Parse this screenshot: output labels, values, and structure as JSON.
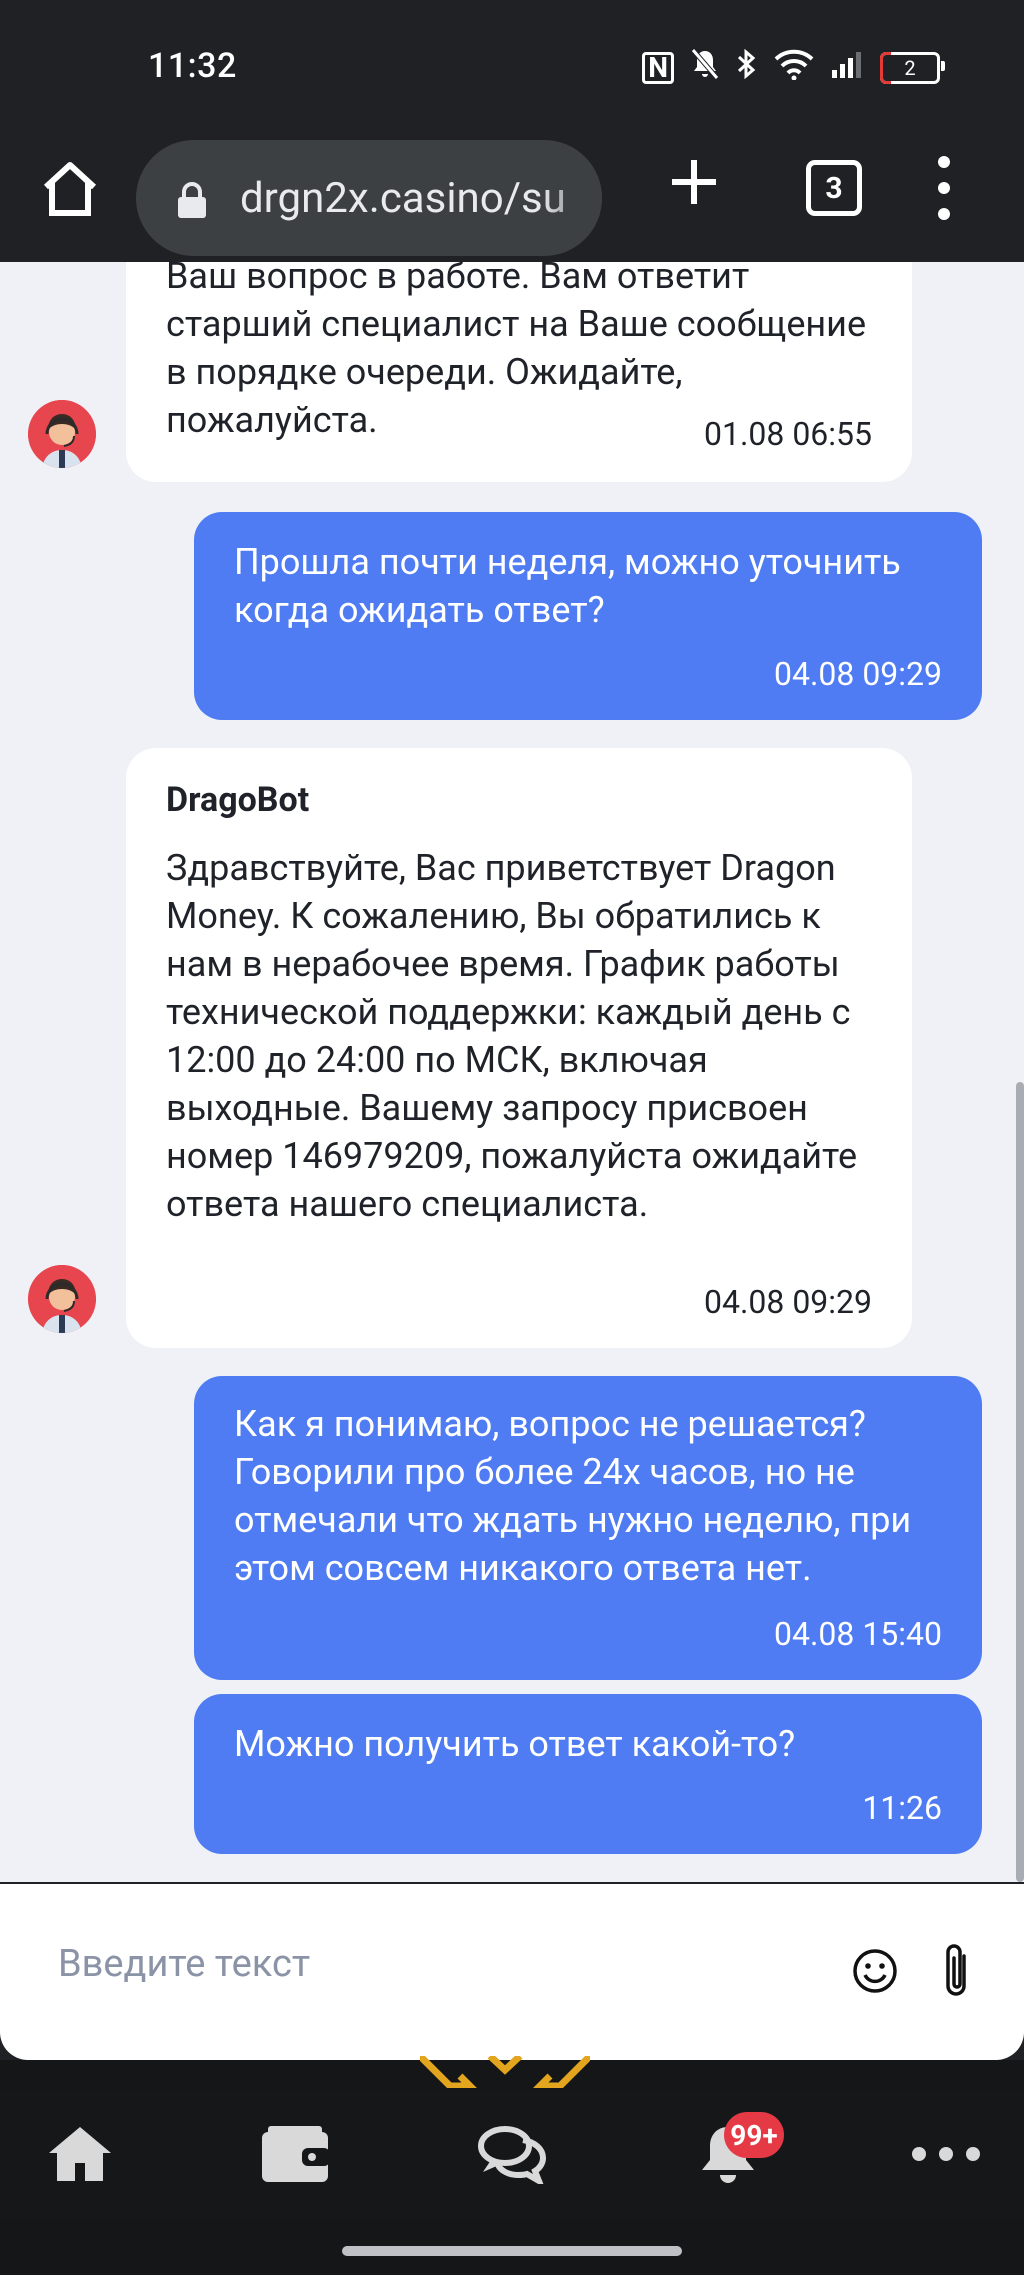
{
  "status_bar": {
    "time": "11:32",
    "battery_level": "2",
    "icons": [
      "nfc-icon",
      "mute-icon",
      "bluetooth-icon",
      "wifi-icon",
      "signal-icon",
      "battery-icon"
    ]
  },
  "browser": {
    "url": "drgn2x.casino/su",
    "tab_count": "3"
  },
  "chat": {
    "messages": [
      {
        "direction": "incoming",
        "text": "Ваш вопрос в работе. Вам ответит старший специалист на Ваше сообщение в порядке очереди. Ожидайте, пожалуйста.",
        "time": "01.08 06:55"
      },
      {
        "direction": "outgoing",
        "text": "Прошла почти неделя, можно уточнить когда ожидать ответ?",
        "time": "04.08 09:29"
      },
      {
        "direction": "incoming",
        "sender": "DragoBot",
        "text": "Здравствуйте, Вас приветствует Dragon Money. К сожалению, Вы обратились к нам в нерабочее время. График работы технической поддержки: каждый день с 12:00 до 24:00 по МСК, включая выходные. Вашему запросу присвоен номер 146979209, пожалуйста ожидайте ответа нашего специалиста.",
        "time": "04.08 09:29"
      },
      {
        "direction": "outgoing",
        "text": "Как я понимаю, вопрос не решается? Говорили про более 24х часов, но не отмечали что ждать нужно неделю, при этом совсем никакого ответа нет.",
        "time": "04.08 15:40"
      },
      {
        "direction": "outgoing",
        "text": "Можно получить ответ какой-то?",
        "time": "11:26"
      }
    ]
  },
  "input": {
    "placeholder": "Введите текст"
  },
  "nav": {
    "notifications_badge": "99+",
    "items": [
      "home-icon",
      "wallet-icon",
      "chat-icon",
      "bell-icon",
      "more-icon"
    ]
  },
  "colors": {
    "outgoing_bubble": "#4f7cf2",
    "incoming_bubble": "#ffffff",
    "chat_background": "#eff1f6",
    "badge": "#e53945"
  }
}
